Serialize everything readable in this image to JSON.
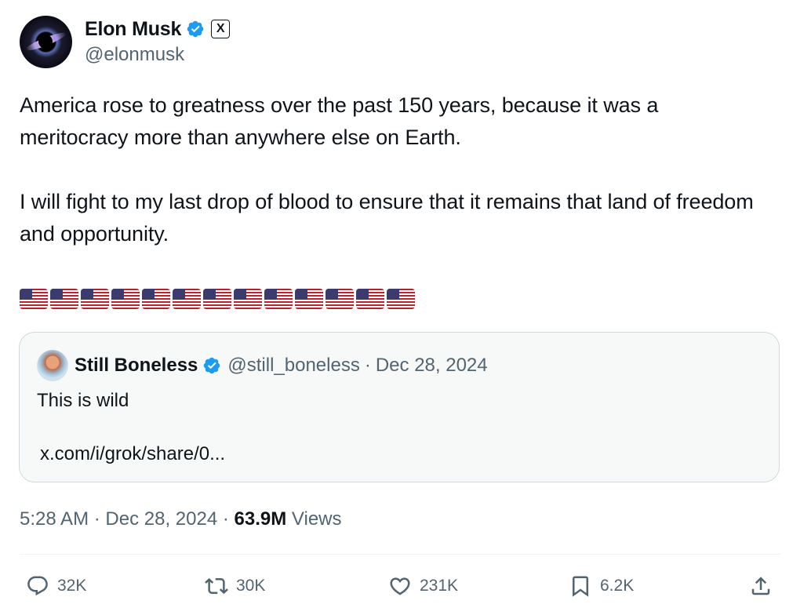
{
  "author": {
    "name": "Elon Musk",
    "handle": "@elonmusk",
    "verified": true,
    "affiliate_badge": "X"
  },
  "tweet": {
    "text": "America rose to greatness over the past 150 years, because it was a meritocracy more than anywhere else on Earth.\n\nI will fight to my last drop of blood to ensure that it remains that land of freedom and opportunity.",
    "flag_emoji": "🇺🇸",
    "flag_count": 13
  },
  "quoted_tweet": {
    "name": "Still Boneless",
    "handle": "@still_boneless",
    "separator": "·",
    "date": "Dec 28, 2024",
    "text": "This is wild",
    "link": "x.com/i/grok/share/0..."
  },
  "meta": {
    "time": "5:28 AM",
    "separator": "·",
    "date": "Dec 28, 2024",
    "views_count": "63.9M",
    "views_label": "Views"
  },
  "actions": {
    "replies": "32K",
    "reposts": "30K",
    "likes": "231K",
    "bookmarks": "6.2K"
  },
  "colors": {
    "text": "#0f1419",
    "secondary": "#536471",
    "verified_blue": "#1d9bf0",
    "border": "#cfd9de",
    "quote_bg": "#f7f9f9"
  },
  "icons": [
    "verified-badge-icon",
    "x-logo-icon",
    "reply-icon",
    "repost-icon",
    "like-icon",
    "bookmark-icon",
    "share-icon"
  ]
}
